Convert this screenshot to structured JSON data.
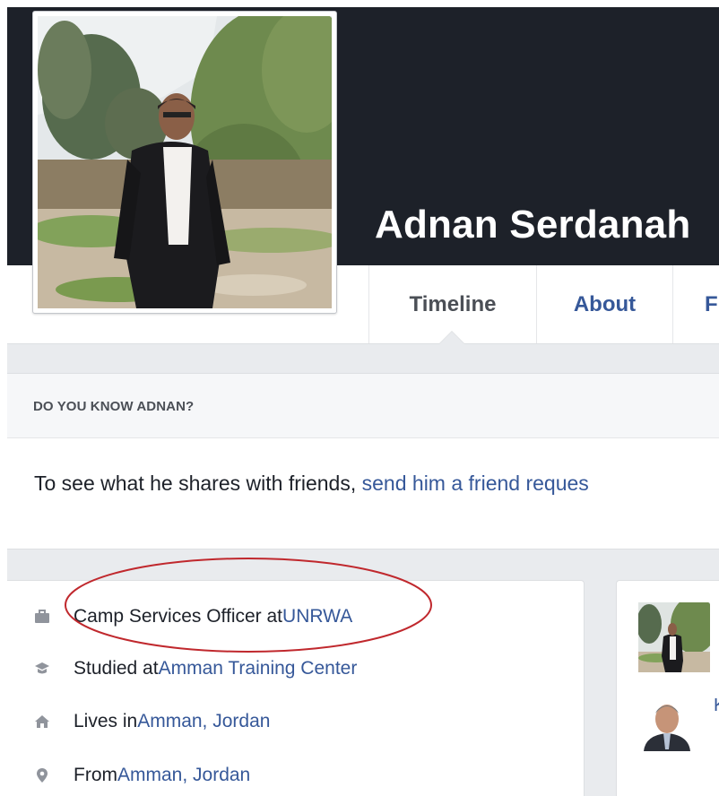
{
  "profile": {
    "name": "Adnan Serdanah"
  },
  "tabs": [
    {
      "label": "Timeline",
      "active": true
    },
    {
      "label": "About"
    },
    {
      "label": "F"
    }
  ],
  "know_box": {
    "title": "DO YOU KNOW ADNAN?"
  },
  "share": {
    "prefix": "To see what he shares with friends, ",
    "link": "send him a friend reques"
  },
  "intro": {
    "work": {
      "icon": "briefcase-icon",
      "prefix": "Camp Services Officer at ",
      "link": "UNRWA"
    },
    "education": {
      "icon": "graduation-cap-icon",
      "prefix": "Studied at ",
      "link": "Amman Training Center"
    },
    "lives": {
      "icon": "house-icon",
      "prefix": "Lives in ",
      "link": "Amman, Jordan"
    },
    "from": {
      "icon": "location-pin-icon",
      "prefix": "From ",
      "link": "Amman, Jordan"
    }
  },
  "right_card": {
    "friend_initial": "K"
  },
  "colors": {
    "cover": "#1d2129",
    "link": "#365899",
    "annotation": "#c0282d"
  }
}
